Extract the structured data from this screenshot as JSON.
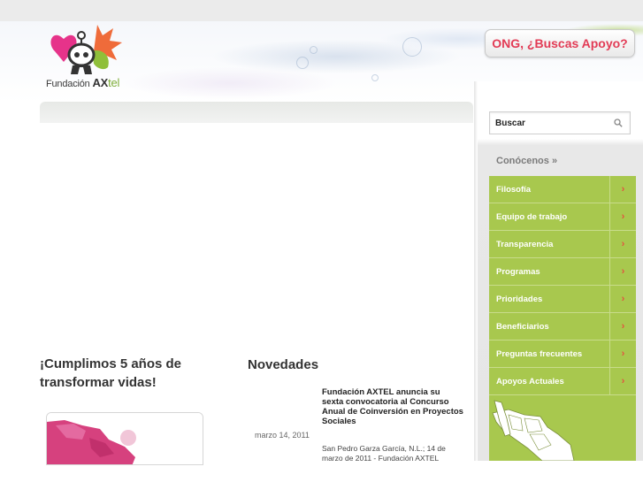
{
  "header": {
    "logo_text": "Fundación",
    "logo_brand": "AX",
    "logo_brand_suffix": "tel",
    "cta_label": "ONG, ¿Buscas Apoyo?"
  },
  "search": {
    "value": "Buscar"
  },
  "sidebar": {
    "heading": "Conócenos »",
    "items": [
      {
        "label": "Filosofía"
      },
      {
        "label": "Equipo de trabajo"
      },
      {
        "label": "Transparencia"
      },
      {
        "label": "Programas"
      },
      {
        "label": "Prioridades"
      },
      {
        "label": "Beneficiarios"
      },
      {
        "label": "Preguntas frecuentes"
      },
      {
        "label": "Apoyos Actuales"
      }
    ],
    "arrow_glyph": "›"
  },
  "feature": {
    "title": "¡Cumplimos 5 años de transformar vidas!"
  },
  "news": {
    "section_title": "Novedades",
    "date": "marzo 14, 2011",
    "headline": "Fundación AXTEL anuncia su sexta convocatoria al Concurso Anual de Coinversión en Proyectos Sociales",
    "excerpt": "San Pedro Garza García, N.L.;  14 de marzo de 2011 - Fundación AXTEL"
  },
  "colors": {
    "accent_green": "#a8c84e",
    "cta_red": "#e23b55",
    "arrow_red": "#e4513f"
  }
}
